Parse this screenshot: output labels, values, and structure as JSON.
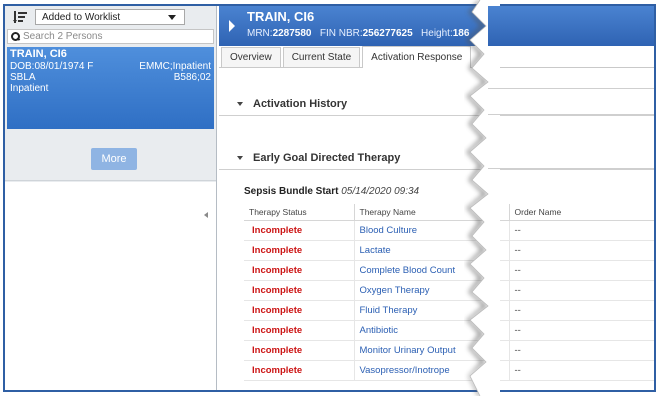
{
  "left_panel": {
    "worklist_value": "Added to Worklist",
    "search_placeholder": "Search 2 Persons",
    "patient": {
      "name": "TRAIN, CI6",
      "dob": "DOB:08/01/1974 F",
      "facility": "EMMC;Inpatient",
      "unit": "SBLA",
      "room": "B586;02",
      "encounter_type": "Inpatient"
    },
    "more_label": "More"
  },
  "banner": {
    "name": "TRAIN, CI6",
    "mrn_label": "MRN:",
    "mrn": "2287580",
    "fin_label": "FIN NBR:",
    "fin": "256277625",
    "height_label": "Height:",
    "height": "186"
  },
  "tabs": [
    "Overview",
    "Current State",
    "Activation Response"
  ],
  "active_tab": "Activation Response",
  "sections": {
    "history": "Activation History",
    "egdt": "Early Goal Directed Therapy"
  },
  "bundle": {
    "label": "Sepsis Bundle Start",
    "datetime": "05/14/2020 09:34"
  },
  "table": {
    "headers": [
      "Therapy Status",
      "Therapy Name",
      "Order Name"
    ],
    "rows": [
      {
        "status": "Incomplete",
        "name": "Blood Culture",
        "order": "--"
      },
      {
        "status": "Incomplete",
        "name": "Lactate",
        "order": "--"
      },
      {
        "status": "Incomplete",
        "name": "Complete Blood Count",
        "order": "--"
      },
      {
        "status": "Incomplete",
        "name": "Oxygen Therapy",
        "order": "--"
      },
      {
        "status": "Incomplete",
        "name": "Fluid Therapy",
        "order": "--"
      },
      {
        "status": "Incomplete",
        "name": "Antibiotic",
        "order": "--"
      },
      {
        "status": "Incomplete",
        "name": "Monitor Urinary Output",
        "order": "--"
      },
      {
        "status": "Incomplete",
        "name": "Vasopressor/Inotrope",
        "order": "--"
      }
    ]
  },
  "colors": {
    "accent_blue": "#2f63b3",
    "status_red": "#cc1414",
    "link_blue": "#2b5fb3"
  }
}
